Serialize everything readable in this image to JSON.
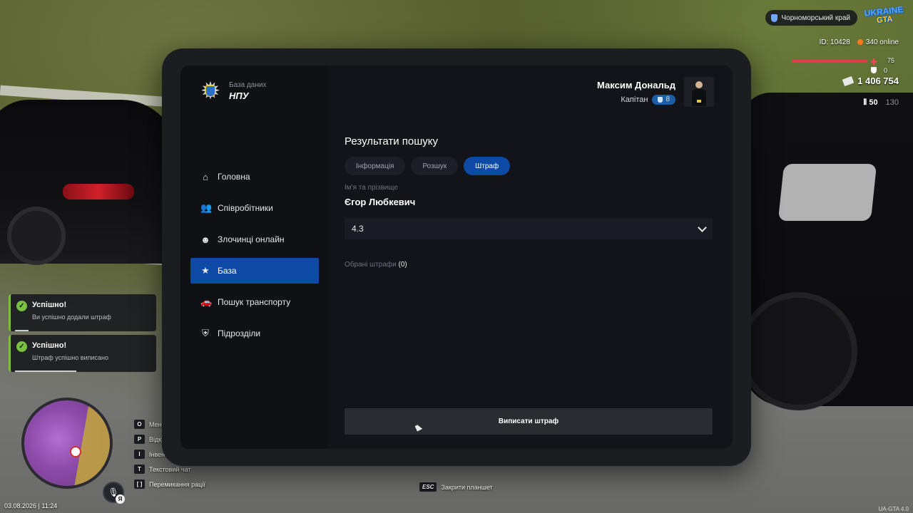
{
  "hud": {
    "region": "Чорноморський край",
    "logo_line1": "UKRAINE",
    "logo_line2": "GTA",
    "player_id": "ID: 10428",
    "online": "340 online",
    "health": "75",
    "armor": "0",
    "money": "1 406 754",
    "ammo_clip": "50",
    "ammo_total": "130"
  },
  "notifications": [
    {
      "title": "Успішно!",
      "message": "Ви успішно додали штраф",
      "progress": 0.1
    },
    {
      "title": "Успішно!",
      "message": "Штраф успішно виписано",
      "progress": 0.45
    }
  ],
  "hotkeys": [
    {
      "key": "O",
      "label": "Меню"
    },
    {
      "key": "P",
      "label": "Відкрити"
    },
    {
      "key": "I",
      "label": "Інвентар"
    },
    {
      "key": "T",
      "label": "Текстовий чат"
    },
    {
      "key": "[ ]",
      "label": "Перемикання рації"
    }
  ],
  "mic_lang": "Я",
  "datetime": "03.08.2026 | 11:24",
  "esc_key": "ESC",
  "esc_hint": "Закрити планшет",
  "version": "UA-GTA 4.0",
  "tablet": {
    "brand_sub": "База даних",
    "brand_name": "НПУ",
    "nav": [
      {
        "label": "Головна",
        "icon": "home-icon"
      },
      {
        "label": "Співробітники",
        "icon": "users-icon"
      },
      {
        "label": "Злочинці онлайн",
        "icon": "criminal-icon"
      },
      {
        "label": "База",
        "icon": "star-icon",
        "active": true
      },
      {
        "label": "Пошук транспорту",
        "icon": "car-icon"
      },
      {
        "label": "Підрозділи",
        "icon": "shield-icon"
      }
    ],
    "profile": {
      "name": "Максим Дональд",
      "rank": "Капітан",
      "level": "8"
    },
    "section_title": "Результати пошуку",
    "tabs": [
      {
        "label": "Інформація"
      },
      {
        "label": "Розшук"
      },
      {
        "label": "Штраф",
        "active": true
      }
    ],
    "field_label": "Ім'я та прізвище",
    "person_name": "Єгор Любкевич",
    "fine_select_value": "4.3",
    "selected_fines_label": "Обрані штрафи",
    "selected_fines_count": "(0)",
    "submit_label": "Виписати штраф"
  }
}
